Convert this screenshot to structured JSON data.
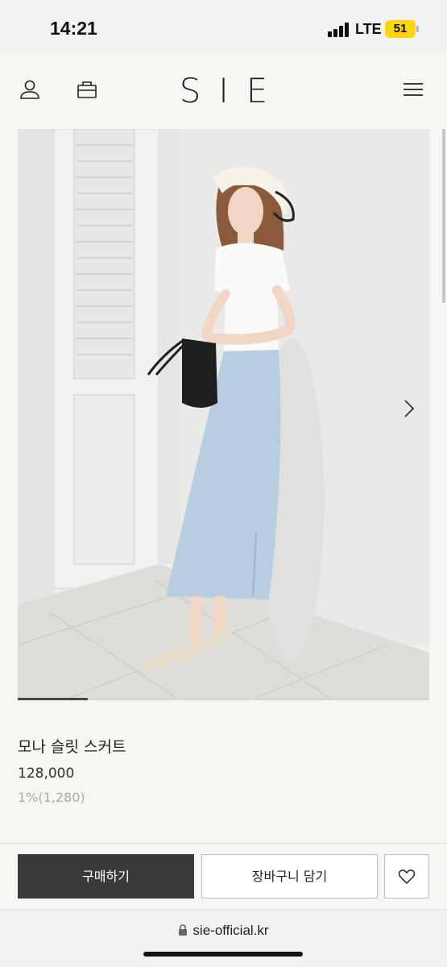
{
  "status_bar": {
    "time": "14:21",
    "network": "LTE",
    "battery": "51",
    "battery_color": "#ffd60a"
  },
  "header": {
    "logo": "SIE",
    "icons": [
      "user-icon",
      "bag-icon",
      "menu-icon"
    ]
  },
  "hero": {
    "image_alt": "product-photo",
    "slide_progress": 0.17,
    "next_icon": "chevron-right-icon"
  },
  "product": {
    "name": "모나 슬릿 스커트",
    "price": "128,000",
    "points": "1%(1,280)"
  },
  "actions": {
    "buy_label": "구매하기",
    "cart_label": "장바구니 담기",
    "wish_icon": "heart-icon",
    "buy_color": "#3a3a3a"
  },
  "browser": {
    "url": "sie-official.kr",
    "lock_icon": "lock-icon"
  }
}
